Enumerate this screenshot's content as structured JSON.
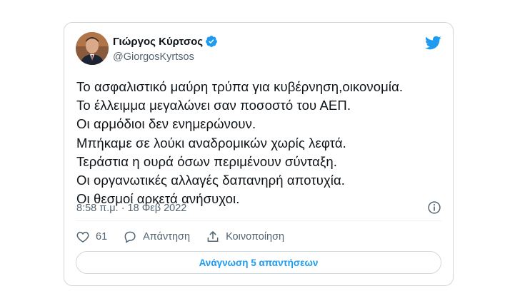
{
  "tweet": {
    "author_name": "Γιώργος Κύρτσος",
    "author_handle": "@GiorgosKyrtsos",
    "verified": true,
    "text": "Το ασφαλιστικό μαύρη τρύπα για κυβέρνηση,οικονομία.\nΤο έλλειμμα μεγαλώνει σαν ποσοστό του ΑΕΠ.\nΟι αρμόδιοι δεν ενημερώνουν.\nΜπήκαμε σε λούκι αναδρομικών χωρίς λεφτά.\nΤεράστια η ουρά όσων περιμένουν σύνταξη.\nΟι οργανωτικές αλλαγές δαπανηρή αποτυχία.\nΟι θεσμοί αρκετά ανήσυχοι.",
    "timestamp": "8:58 π.μ. · 18 Φεβ 2022"
  },
  "actions": {
    "like_count": "61",
    "reply_label": "Απάντηση",
    "share_label": "Κοινοποίηση"
  },
  "read_replies_label": "Ανάγνωση 5 απαντήσεων",
  "colors": {
    "accent": "#1d9bf0",
    "text": "#0f1419",
    "secondary": "#536471",
    "border": "#cfd9de"
  },
  "icons": [
    "twitter-bird-icon",
    "verified-badge-icon",
    "info-icon",
    "heart-icon",
    "reply-icon",
    "share-icon"
  ]
}
